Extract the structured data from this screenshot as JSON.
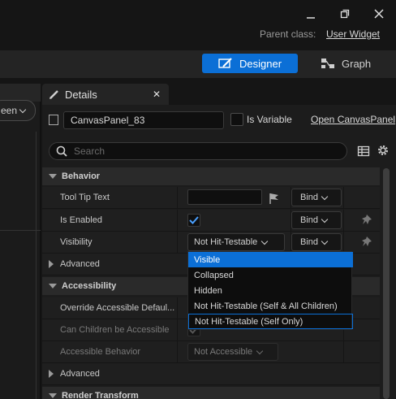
{
  "window": {
    "parent_class_label": "Parent class:",
    "parent_class_value": "User Widget"
  },
  "modes": {
    "designer_label": "Designer",
    "graph_label": "Graph"
  },
  "left_pane": {
    "dropdown_label": "een"
  },
  "details": {
    "tab_label": "Details",
    "widget_name": "CanvasPanel_83",
    "is_variable_label": "Is Variable",
    "open_link": "Open CanvasPanel",
    "search_placeholder": "Search"
  },
  "sections": {
    "behavior": "Behavior",
    "accessibility": "Accessibility",
    "render_transform": "Render Transform"
  },
  "rows": {
    "tooltip": "Tool Tip Text",
    "is_enabled": "Is Enabled",
    "visibility": "Visibility",
    "advanced": "Advanced",
    "override_accessible": "Override Accessible Defaul...",
    "can_children": "Can Children be Accessible",
    "accessible_behavior": "Accessible Behavior",
    "advanced2": "Advanced"
  },
  "values": {
    "bind_label": "Bind",
    "visibility_value": "Not Hit-Testable",
    "accessible_behavior_value": "Not Accessible"
  },
  "visibility_menu": {
    "options": [
      "Visible",
      "Collapsed",
      "Hidden",
      "Not Hit-Testable (Self & All Children)",
      "Not Hit-Testable (Self Only)"
    ]
  },
  "colors": {
    "accent": "#0b6fd6"
  }
}
